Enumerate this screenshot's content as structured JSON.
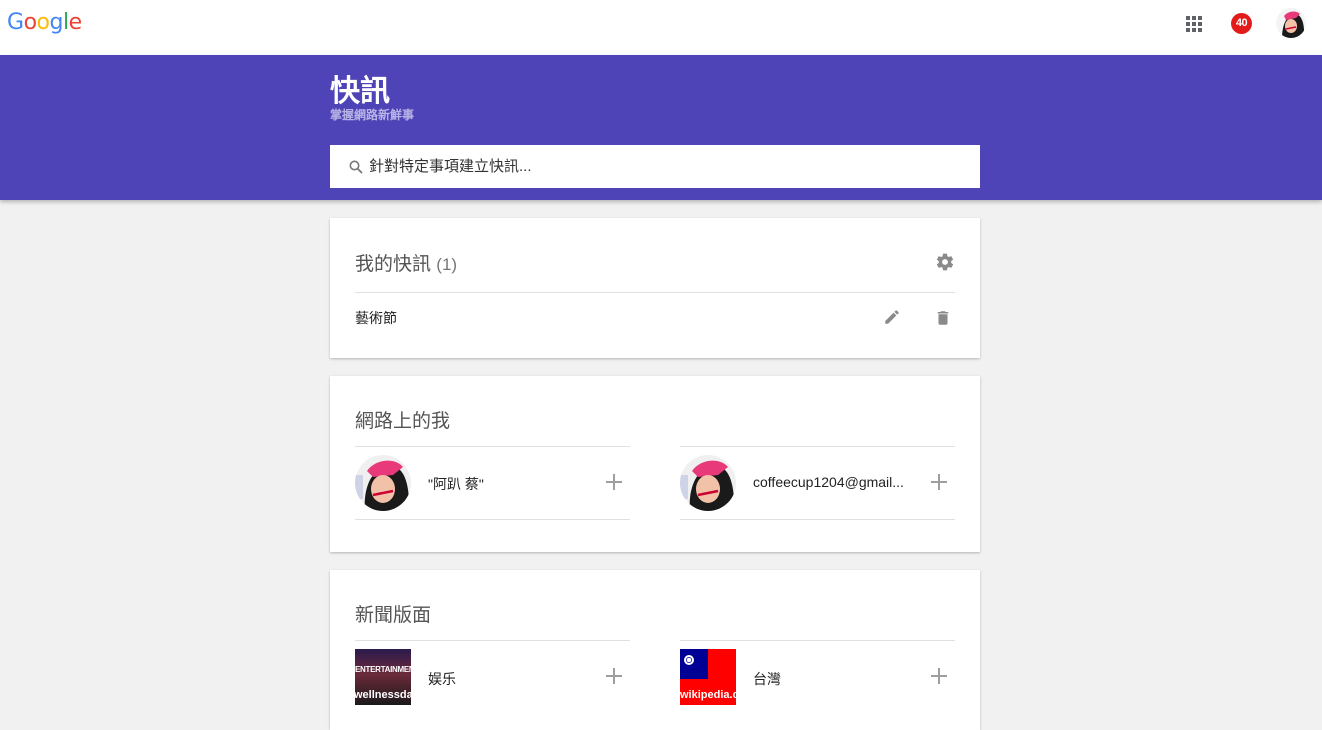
{
  "header": {
    "logo_text": "Google",
    "notification_count": "40"
  },
  "banner": {
    "title": "快訊",
    "subtitle": "掌握網路新鮮事",
    "search_placeholder": "針對特定事項建立快訊..."
  },
  "my_alerts": {
    "title": "我的快訊",
    "count": "(1)",
    "items": [
      {
        "label": "藝術節"
      }
    ]
  },
  "me_on_web": {
    "title": "網路上的我",
    "items": [
      {
        "label": "\"阿趴 蔡\""
      },
      {
        "label": "coffeecup1204@gmail..."
      }
    ]
  },
  "news_pages": {
    "title": "新聞版面",
    "items": [
      {
        "label": "娱乐",
        "thumb_text": "wellnessda",
        "thumb_caption": "ENTERTAINMENT"
      },
      {
        "label": "台灣",
        "thumb_text": "wikipedia.c"
      }
    ]
  },
  "colors": {
    "banner": "#4e44b7",
    "badge": "#e21b1b"
  }
}
